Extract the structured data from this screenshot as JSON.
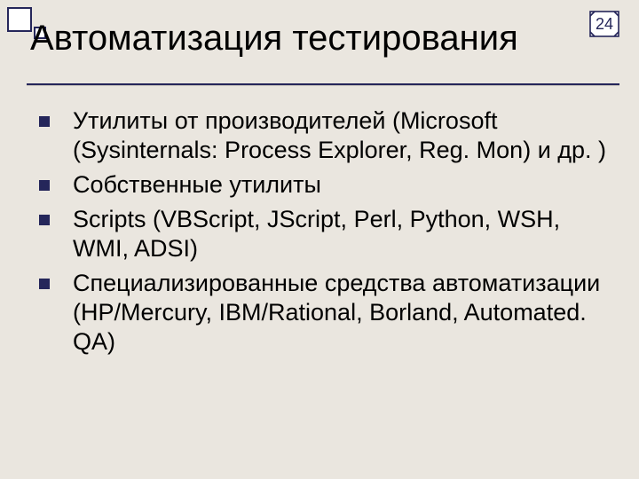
{
  "slide_number": "24",
  "title": "Автоматизация тестирования",
  "bullets": [
    "Утилиты от производителей (Microsoft (Sysinternals: Process Explorer, Reg. Mon) и др. )",
    "Собственные утилиты",
    "Scripts (VBScript, JScript, Perl, Python, WSH, WMI, ADSI)",
    "Специализированные средства автоматизации (HP/Mercury, IBM/Rational, Borland, Automated. QA)"
  ]
}
